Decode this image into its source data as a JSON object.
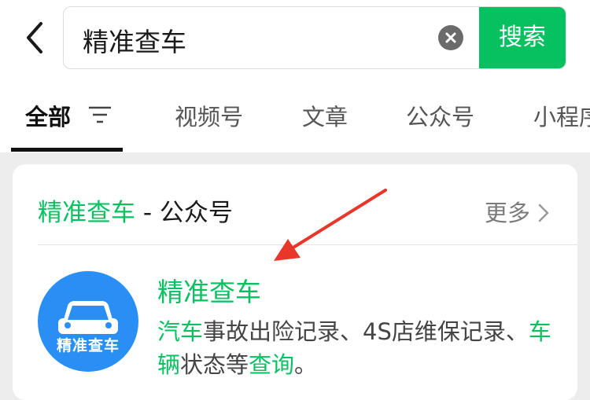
{
  "search": {
    "query": "精准查车",
    "button_label": "搜索"
  },
  "tabs": [
    {
      "label": "全部"
    },
    {
      "label": "视频号"
    },
    {
      "label": "文章"
    },
    {
      "label": "公众号"
    },
    {
      "label": "小程序"
    }
  ],
  "card": {
    "title_highlight": "精准查车",
    "title_suffix": " - 公众号",
    "more_label": "更多",
    "account": {
      "logo_text": "精准查车",
      "name": "精准查车",
      "desc": {
        "p1": "汽车",
        "p2": "事故出险记录、4S店维保记录、",
        "p3": "车辆",
        "p4": "状态等",
        "p5": "查询",
        "p6": "。"
      }
    }
  },
  "colors": {
    "accent": "#07c160",
    "logo_bg": "#2a8ff5",
    "annotation_arrow": "#e8362a"
  },
  "icons": [
    "back-chevron-icon",
    "clear-icon",
    "filter-icon",
    "chevron-right-icon",
    "car-icon",
    "annotation-arrow"
  ]
}
